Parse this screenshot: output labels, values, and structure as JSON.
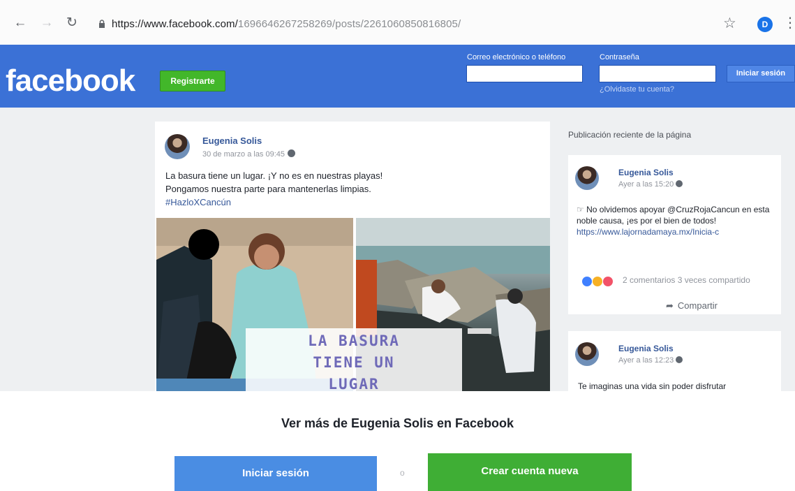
{
  "browser": {
    "url_host": "https://www.facebook.com/",
    "url_path": "1696646267258269/posts/2261060850816805/",
    "profile_initial": "D",
    "icons": [
      "back-icon",
      "forward-icon",
      "reload-icon",
      "lock-icon",
      "star-icon",
      "menu-icon"
    ]
  },
  "header": {
    "logo": "facebook",
    "register_label": "Registrarte",
    "email_label": "Correo electrónico o teléfono",
    "password_label": "Contraseña",
    "login_label": "Iniciar sesión",
    "forgot_label": "¿Olvidaste tu cuenta?"
  },
  "post": {
    "author": "Eugenia Solis",
    "timestamp": "30 de marzo a las 09:45",
    "text_lines": [
      "La basura tiene un lugar. ¡Y no es en nuestras playas!",
      "Pongamos nuestra parte para mantenerlas limpias."
    ],
    "hashtag": "#HazloXCancún",
    "image_text": [
      "LA BASURA",
      "TIENE UN",
      "LUGAR"
    ]
  },
  "sidebar": {
    "title": "Publicación reciente de la página",
    "card1": {
      "author": "Eugenia Solis",
      "timestamp": "Ayer a las 15:20",
      "text": "No olvidemos apoyar @CruzRojaCancun en esta noble causa, ¡es por el bien de todos!",
      "link": "https://www.lajornadamaya.mx/Inicia-c",
      "stats": "2 comentarios  3 veces compartido",
      "share_label": "Compartir"
    },
    "card2": {
      "author": "Eugenia Solis",
      "timestamp": "Ayer a las 12:23",
      "text": "Te imaginas una vida sin poder disfrutar"
    }
  },
  "cta": {
    "title": "Ver más de Eugenia Solis en Facebook",
    "login_label": "Iniciar sesión",
    "or_label": "o",
    "create_label": "Crear cuenta nueva"
  },
  "colors": {
    "fb_blue": "#3b71d6",
    "register_green": "#42b72a",
    "create_green": "#3fae35",
    "login_blue": "#4a8de3",
    "link_blue": "#365899"
  }
}
